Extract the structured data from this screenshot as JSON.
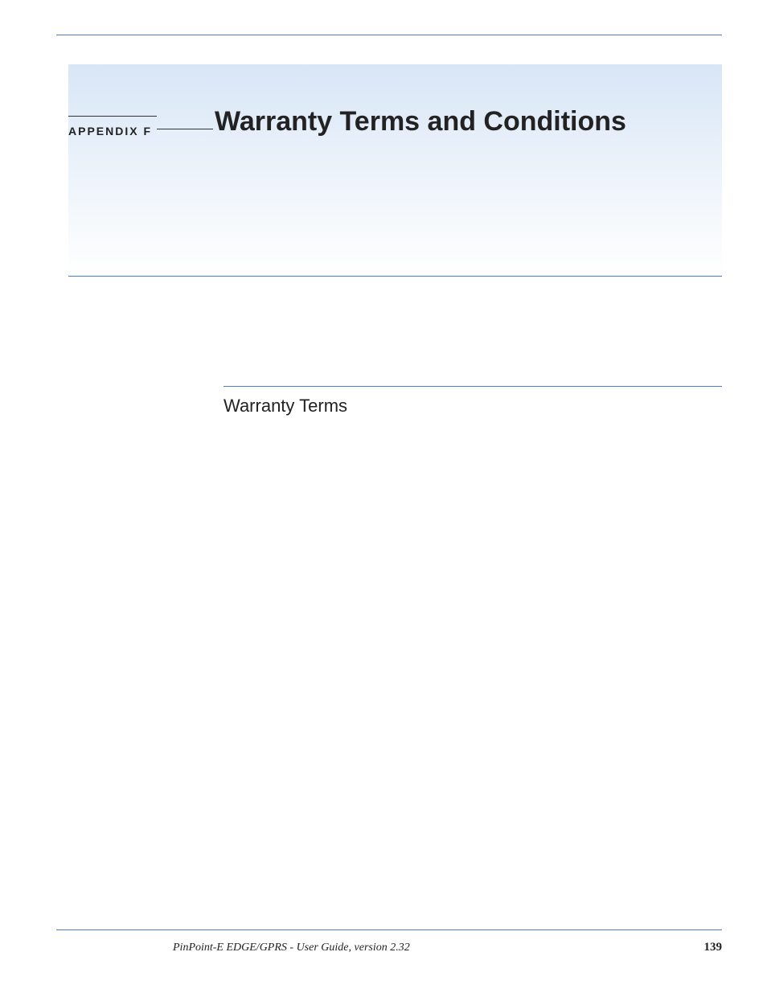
{
  "header": {
    "appendix_label": "APPENDIX F",
    "title": "Warranty Terms and Conditions"
  },
  "section": {
    "heading": "Warranty Terms"
  },
  "footer": {
    "doc_title": "PinPoint-E EDGE/GPRS - User Guide, version 2.32",
    "page_number": "139"
  }
}
